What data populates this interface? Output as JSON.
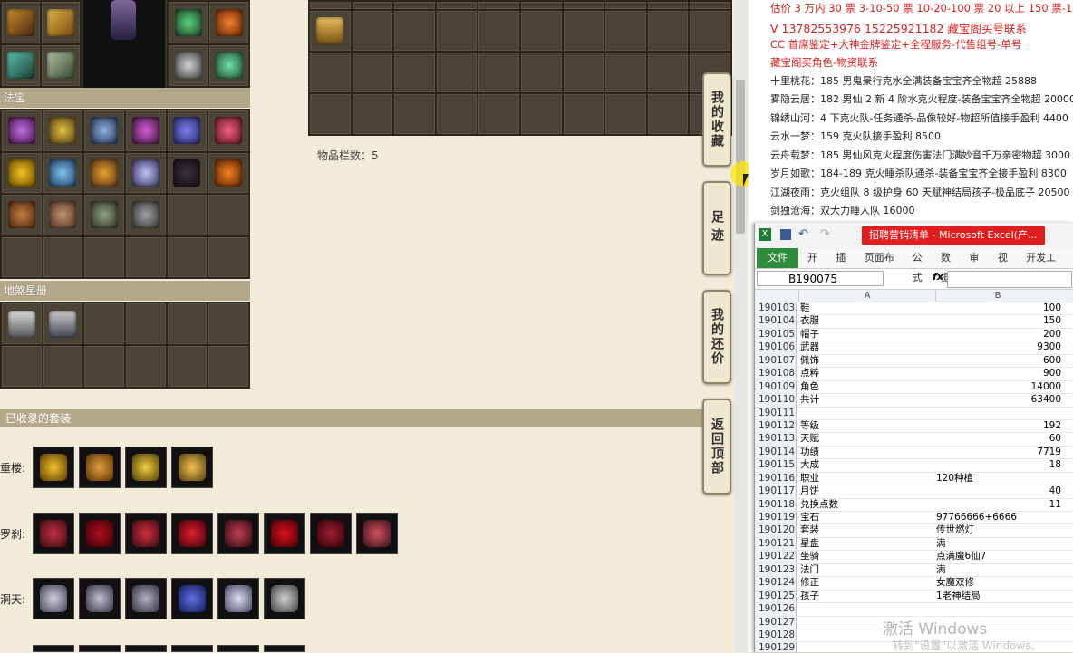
{
  "left_panel": {
    "section_fabao": "法宝",
    "section_album": "地煞星册",
    "collected_header": "已收录的套装",
    "set_rows": [
      {
        "label": "重楼:",
        "count": 4
      },
      {
        "label": "罗刹:",
        "count": 8
      },
      {
        "label": "洞天:",
        "count": 6
      }
    ]
  },
  "center_panel": {
    "items_count_label": "物品栏数：5"
  },
  "side_tabs": [
    {
      "label": "我的收藏"
    },
    {
      "label": "足迹"
    },
    {
      "label": "我的还价"
    },
    {
      "label": "返回顶部"
    }
  ],
  "right_text": {
    "lines_red": [
      "估价 3 万内 30 票  3-10-50 票  10-20-100 票  20 以上 150 票-1 票 1 元",
      "V 13782553976    15225921182   藏宝阁买号联系",
      "CC 首席鉴定+大神金牌鉴定+全程服务-代售组号-单号",
      "藏宝阁买角色-物资联系"
    ],
    "lines_black": [
      "十里桃花：185 男鬼景行克水全满装备宝宝齐全物超 25888",
      "雾隐云居：182 男仙 2 新 4 阶水克火程度-装备宝宝齐全物超 20000",
      "锦绣山河：4 下克火队-任务通杀-品像较好-物超所值接手盈利 4400",
      "云水一梦：159 克火队接手盈利 8500",
      "云舟载梦：185 男仙风克火程度伤害法门满妙音千万亲密物超 3000",
      "岁月如歌：184-189 克火睡杀队通杀-装备宝宝齐全接手盈利 8300",
      "江湖夜雨：克火组队 8 级护身 60 天赋神结局孩子-极品底子 20500",
      "剑独沧海：双大力睡人队 16000"
    ]
  },
  "excel": {
    "title": "招聘营销清单 - Microsoft Excel(产...",
    "file_tab": "文件",
    "tabs": [
      "开始",
      "插入",
      "页面布局",
      "公式",
      "数据",
      "审阅",
      "视图",
      "开发工具"
    ],
    "name_box": "B190075",
    "fx": "fx",
    "col_a": "A",
    "col_b": "B",
    "rows": [
      {
        "n": "190103",
        "a": "鞋",
        "b": "100",
        "num": true
      },
      {
        "n": "190104",
        "a": "衣服",
        "b": "150",
        "num": true
      },
      {
        "n": "190105",
        "a": "帽子",
        "b": "200",
        "num": true
      },
      {
        "n": "190106",
        "a": "武器",
        "b": "9300",
        "num": true
      },
      {
        "n": "190107",
        "a": "佩饰",
        "b": "600",
        "num": true
      },
      {
        "n": "190108",
        "a": "点粹",
        "b": "900",
        "num": true
      },
      {
        "n": "190109",
        "a": "角色",
        "b": "14000",
        "num": true
      },
      {
        "n": "190110",
        "a": "共计",
        "b": "63400",
        "num": true
      },
      {
        "n": "190111",
        "a": "",
        "b": "",
        "num": true
      },
      {
        "n": "190112",
        "a": "等级",
        "b": "192",
        "num": true
      },
      {
        "n": "190113",
        "a": "天赋",
        "b": "60",
        "num": true
      },
      {
        "n": "190114",
        "a": "功绩",
        "b": "7719",
        "num": true
      },
      {
        "n": "190115",
        "a": "大成",
        "b": "18",
        "num": true
      },
      {
        "n": "190116",
        "a": "职业",
        "b": "120种植",
        "num": false
      },
      {
        "n": "190117",
        "a": "月饼",
        "b": "40",
        "num": true
      },
      {
        "n": "190118",
        "a": "兑换点数",
        "b": "11",
        "num": true
      },
      {
        "n": "190119",
        "a": "宝石",
        "b": "97766666+6666",
        "num": false
      },
      {
        "n": "190120",
        "a": "套装",
        "b": "传世燃灯",
        "num": false
      },
      {
        "n": "190121",
        "a": "星盘",
        "b": "满",
        "num": false
      },
      {
        "n": "190122",
        "a": "坐骑",
        "b": "点满魔6仙7",
        "num": false
      },
      {
        "n": "190123",
        "a": "法门",
        "b": "满",
        "num": false
      },
      {
        "n": "190124",
        "a": "修正",
        "b": "女魔双修",
        "num": false
      },
      {
        "n": "190125",
        "a": "孩子",
        "b": "1老神结局",
        "num": false
      },
      {
        "n": "190126",
        "a": "",
        "b": "",
        "num": true
      },
      {
        "n": "190127",
        "a": "",
        "b": "",
        "num": true
      },
      {
        "n": "190128",
        "a": "",
        "b": "",
        "num": true
      },
      {
        "n": "190129",
        "a": "",
        "b": "",
        "num": true
      },
      {
        "n": "190130",
        "a": "",
        "b": "",
        "num": true
      },
      {
        "n": "190131",
        "a": "",
        "b": "",
        "num": true
      }
    ]
  },
  "watermark": {
    "line1": "激活 Windows",
    "line2": "转到\"设置\"以激活 Windows。"
  }
}
